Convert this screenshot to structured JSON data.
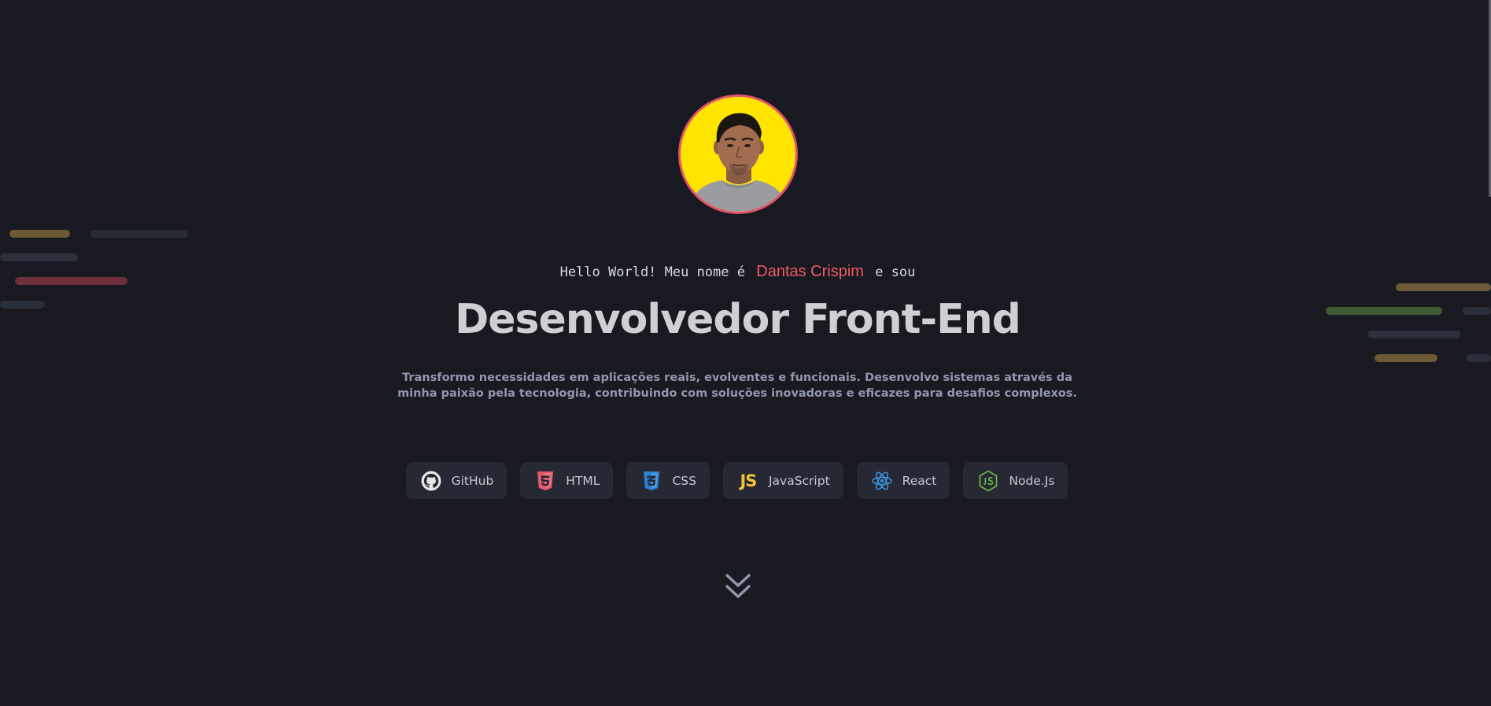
{
  "hero": {
    "intro_prefix": "Hello World! Meu nome é",
    "name": "Dantas Crispim",
    "intro_suffix": "e sou",
    "headline": "Desenvolvedor Front-End",
    "description": "Transformo necessidades em aplicações reais, evolventes e funcionais. Desenvolvo sistemas através da minha paixão pela tecnologia, contribuindo com soluções inovadoras e eficazes para desafios complexos."
  },
  "techs": [
    {
      "label": "GitHub",
      "icon": "github-icon"
    },
    {
      "label": "HTML",
      "icon": "html5-icon"
    },
    {
      "label": "CSS",
      "icon": "css3-icon"
    },
    {
      "label": "JavaScript",
      "icon": "javascript-icon",
      "logo_text": "JS"
    },
    {
      "label": "React",
      "icon": "react-icon"
    },
    {
      "label": "Node.Js",
      "icon": "nodejs-icon"
    }
  ],
  "scroll": {
    "icon": "double-chevron-down-icon"
  },
  "colors": {
    "background": "#191a21",
    "accent": "#ef5a64",
    "chip_bg": "#262833",
    "avatar_ring": "#e0516a",
    "avatar_bg": "#ffe400"
  }
}
